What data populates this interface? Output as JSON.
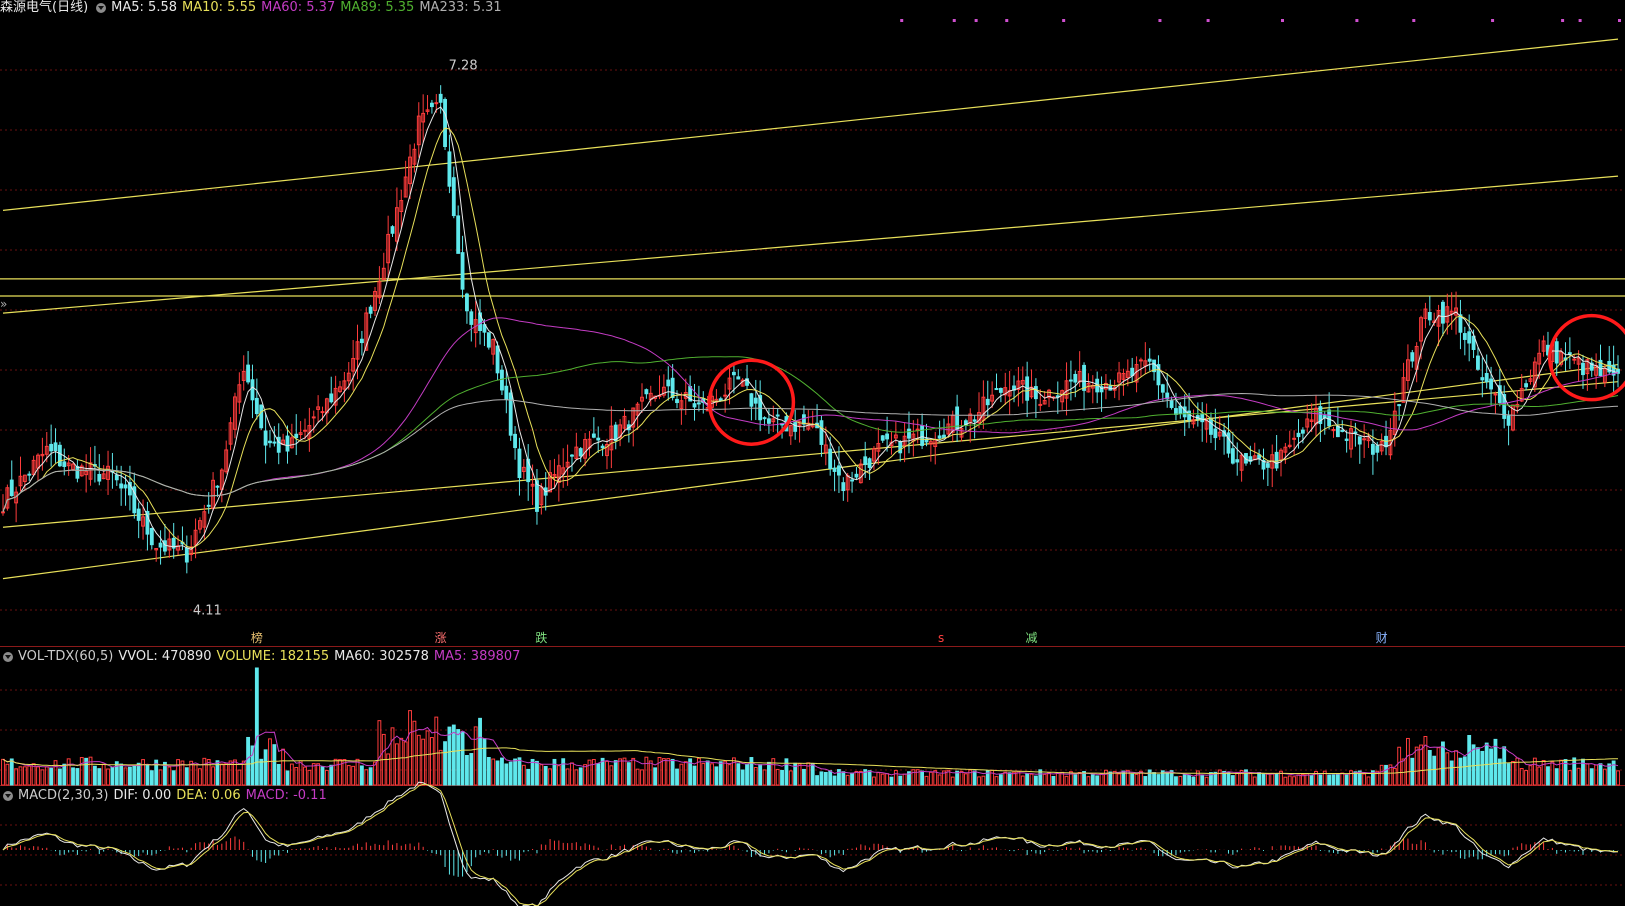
{
  "header": {
    "title": "森源电气(日线)",
    "ma5": "MA5: 5.58",
    "ma10": "MA10: 5.55",
    "ma60": "MA60: 5.37",
    "ma89": "MA89: 5.35",
    "ma233": "MA233: 5.31"
  },
  "vol_legend": {
    "name": "VOL-TDX(60,5)",
    "vvol": "VVOL: 470890",
    "volume": "VOLUME: 182155",
    "ma60": "MA60: 302578",
    "ma5": "MA5: 389807"
  },
  "macd_legend": {
    "name": "MACD(2,30,3)",
    "dif": "DIF: 0.00",
    "dea": "DEA: 0.06",
    "macd": "MACD: -0.11"
  },
  "event_markers": [
    "榜",
    "涨",
    "跌",
    "s",
    "减",
    "财"
  ],
  "expand_glyph": "»",
  "colors": {
    "up": "#ff3c3c",
    "down": "#5fe8ec",
    "ma5": "#e8e8e8",
    "ma10": "#e8e05a",
    "ma60": "#c43cc4",
    "ma89": "#50b030",
    "ma233": "#b0b0b0",
    "trendline": "#e8e05a",
    "grid": "#6a1010",
    "circle": "#ff1a1a"
  },
  "chart_data": {
    "type": "candlestick",
    "title": "森源电气(日线)",
    "annotations": {
      "high": "7.28",
      "low": "4.11"
    },
    "y_range": [
      3.95,
      7.5
    ],
    "anchors": [
      [
        0,
        4.7
      ],
      [
        10,
        5.0
      ],
      [
        15,
        4.9
      ],
      [
        25,
        4.85
      ],
      [
        35,
        4.45
      ],
      [
        42,
        4.4
      ],
      [
        50,
        4.9
      ],
      [
        55,
        5.5
      ],
      [
        60,
        5.05
      ],
      [
        65,
        5.0
      ],
      [
        72,
        5.2
      ],
      [
        80,
        5.5
      ],
      [
        88,
        6.2
      ],
      [
        95,
        6.9
      ],
      [
        100,
        7.0
      ],
      [
        106,
        5.8
      ],
      [
        112,
        5.6
      ],
      [
        118,
        4.9
      ],
      [
        122,
        4.7
      ],
      [
        130,
        5.0
      ],
      [
        140,
        5.1
      ],
      [
        150,
        5.35
      ],
      [
        160,
        5.25
      ],
      [
        168,
        5.4
      ],
      [
        175,
        5.15
      ],
      [
        185,
        5.15
      ],
      [
        192,
        4.8
      ],
      [
        200,
        5.0
      ],
      [
        212,
        5.1
      ],
      [
        222,
        5.2
      ],
      [
        230,
        5.4
      ],
      [
        236,
        5.3
      ],
      [
        244,
        5.4
      ],
      [
        255,
        5.4
      ],
      [
        262,
        5.5
      ],
      [
        268,
        5.2
      ],
      [
        276,
        5.1
      ],
      [
        284,
        4.9
      ],
      [
        292,
        4.95
      ],
      [
        300,
        5.2
      ],
      [
        306,
        5.1
      ],
      [
        315,
        5.0
      ],
      [
        325,
        5.8
      ],
      [
        332,
        5.8
      ],
      [
        338,
        5.4
      ],
      [
        344,
        5.2
      ],
      [
        352,
        5.6
      ],
      [
        360,
        5.5
      ],
      [
        369,
        5.4
      ]
    ],
    "n_candles": 370,
    "moving_averages": [
      {
        "name": "MA5",
        "value": 5.58
      },
      {
        "name": "MA10",
        "value": 5.55
      },
      {
        "name": "MA60",
        "value": 5.37
      },
      {
        "name": "MA89",
        "value": 5.35
      },
      {
        "name": "MA233",
        "value": 5.31
      }
    ],
    "trendlines": [
      {
        "from": [
          0,
          6.4
        ],
        "to": [
          369,
          7.4
        ]
      },
      {
        "from": [
          0,
          5.8
        ],
        "to": [
          369,
          6.6
        ]
      },
      {
        "from": [
          0,
          4.55
        ],
        "to": [
          369,
          5.4
        ]
      },
      {
        "from": [
          0,
          4.25
        ],
        "to": [
          369,
          5.5
        ]
      }
    ],
    "horizontal_levels": [
      6.0,
      5.9
    ],
    "circles": [
      {
        "center": [
          171,
          5.28
        ]
      },
      {
        "center": [
          363,
          5.54
        ]
      }
    ],
    "markers_x": [
      58,
      100,
      123,
      215,
      235,
      315
    ],
    "volume": {
      "pattern": "dense bars with spikes near candle 58 and 90-110, low plateau 190-310"
    },
    "macd": {
      "dif": 0.0,
      "dea": 0.06,
      "macd": -0.11
    }
  }
}
